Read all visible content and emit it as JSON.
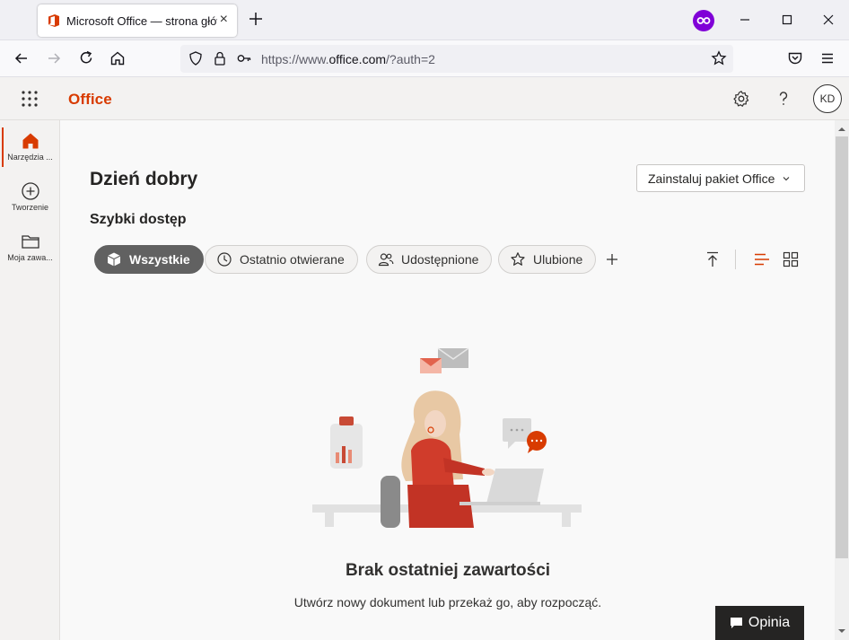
{
  "browser": {
    "tab_title": "Microsoft Office — strona główna",
    "tab_close": "×",
    "url_scheme": "https://www.",
    "url_host": "office.com",
    "url_path": "/?auth=2"
  },
  "app": {
    "brand": "Office",
    "avatar_initials": "KD"
  },
  "rail": {
    "items": [
      {
        "label": "Narzędzia ...",
        "icon": "home-icon",
        "active": true
      },
      {
        "label": "Tworzenie",
        "icon": "plus-circle-icon",
        "active": false
      },
      {
        "label": "Moja zawa...",
        "icon": "folder-icon",
        "active": false
      }
    ]
  },
  "main": {
    "greeting": "Dzień dobry",
    "install_label": "Zainstaluj pakiet Office",
    "section_title": "Szybki dostęp",
    "filters": [
      {
        "label": "Wszystkie",
        "icon": "cube-icon",
        "active": true
      },
      {
        "label": "Ostatnio otwierane",
        "icon": "clock-icon",
        "active": false
      },
      {
        "label": "Udostępnione",
        "icon": "people-icon",
        "active": false
      },
      {
        "label": "Ulubione",
        "icon": "star-icon",
        "active": false
      }
    ],
    "empty_title": "Brak ostatniej zawartości",
    "empty_subtitle": "Utwórz nowy dokument lub przekaż go, aby rozpocząć.",
    "feedback_label": "Opinia"
  },
  "colors": {
    "accent": "#d83b01",
    "private_badge": "#8000d7",
    "active_pill": "#616161"
  }
}
